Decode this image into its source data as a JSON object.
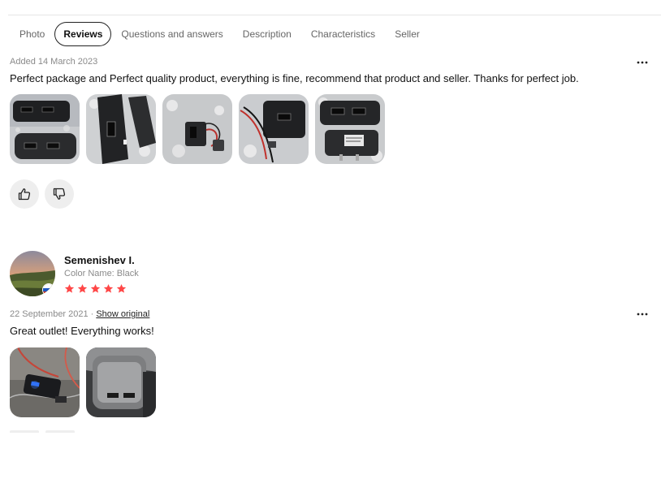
{
  "colors": {
    "accent_text": "#111111",
    "muted_text": "#8a8a8a",
    "star": "#ff4747",
    "vote_bg": "#eeeeee"
  },
  "tabs": [
    {
      "label": "Photo",
      "active": false
    },
    {
      "label": "Reviews",
      "active": true
    },
    {
      "label": "Questions and answers",
      "active": false
    },
    {
      "label": "Description",
      "active": false
    },
    {
      "label": "Characteristics",
      "active": false
    },
    {
      "label": "Seller",
      "active": false
    }
  ],
  "reviews": [
    {
      "date": "Added 14 March 2023",
      "text": "Perfect package and Perfect quality product, everything is fine, recommend that product and seller. Thanks for perfect job.",
      "photo_count": 5,
      "more_icon": "more-dots-icon",
      "like_icon": "thumbs-up-icon",
      "dislike_icon": "thumbs-down-icon"
    },
    {
      "author": "Semenishev I.",
      "attribute": "Color Name: Black",
      "rating": 5,
      "rating_max": 5,
      "country_flag": "russia-flag-icon",
      "date": "22 September 2021",
      "separator": "·",
      "show_original": "Show original",
      "text": "Great outlet! Everything works!",
      "photo_count": 2,
      "more_icon": "more-dots-icon"
    }
  ]
}
